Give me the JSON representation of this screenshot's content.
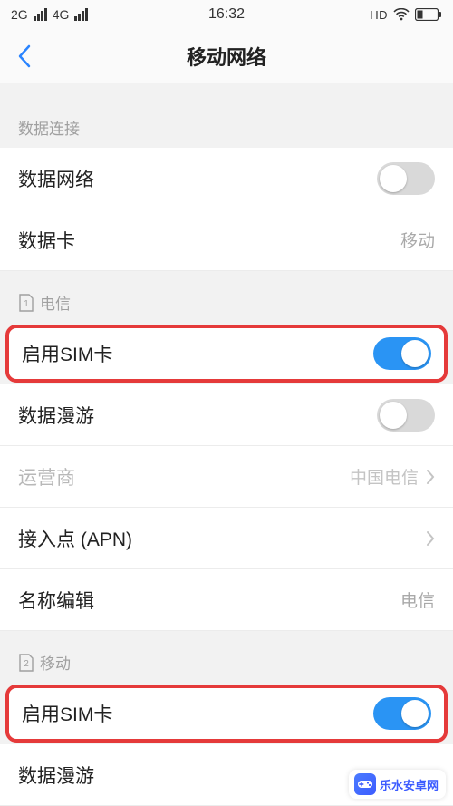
{
  "status_bar": {
    "net1": "2G",
    "net2": "4G",
    "time": "16:32",
    "hd": "HD"
  },
  "header": {
    "title": "移动网络"
  },
  "section1": {
    "header": "数据连接",
    "items": [
      {
        "label": "数据网络",
        "toggle": false
      },
      {
        "label": "数据卡",
        "value": "移动"
      }
    ]
  },
  "section2": {
    "sim_index": "1",
    "header": "电信",
    "items": [
      {
        "label": "启用SIM卡",
        "toggle": true,
        "highlighted": true
      },
      {
        "label": "数据漫游",
        "toggle": false
      },
      {
        "label": "运营商",
        "value": "中国电信",
        "chevron": true,
        "muted": true
      },
      {
        "label": "接入点 (APN)",
        "value": "",
        "chevron": true
      },
      {
        "label": "名称编辑",
        "value": "电信"
      }
    ]
  },
  "section3": {
    "sim_index": "2",
    "header": "移动",
    "items": [
      {
        "label": "启用SIM卡",
        "toggle": true,
        "highlighted": true
      },
      {
        "label": "数据漫游"
      }
    ]
  },
  "watermark": {
    "text": "乐水安卓网"
  }
}
